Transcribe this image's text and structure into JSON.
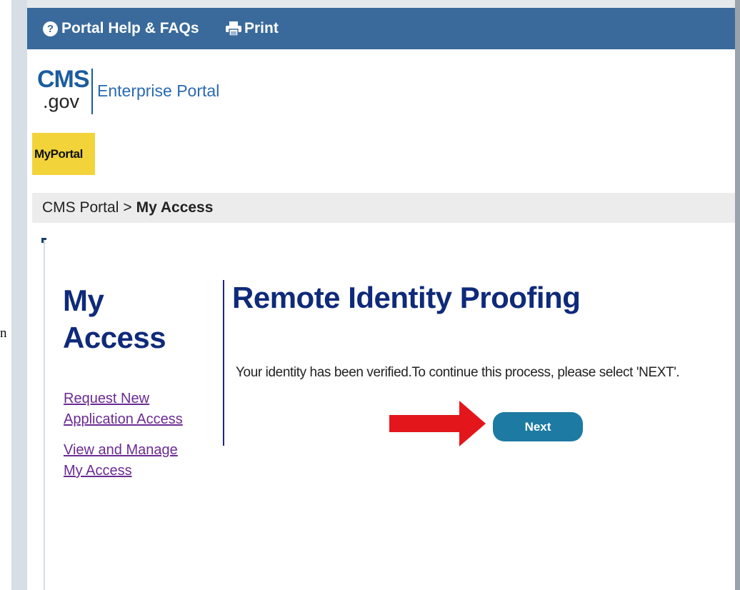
{
  "stray_text": "n",
  "topbar": {
    "help_label": "Portal Help & FAQs",
    "help_icon": "?",
    "print_label": "Print",
    "icons": [
      "question-circle-icon",
      "printer-icon"
    ]
  },
  "logo": {
    "cms": "CMS",
    "gov": ".gov",
    "portal_name": "Enterprise Portal"
  },
  "nav": {
    "tab_label": "MyPortal"
  },
  "breadcrumb": {
    "root": "CMS Portal",
    "separator": ">",
    "current": "My Access"
  },
  "sidebar": {
    "title_line1": "My",
    "title_line2": "Access",
    "links": [
      {
        "line1": "Request New",
        "line2": "Application Access"
      },
      {
        "line1": "View and Manage",
        "line2": "My Access"
      }
    ]
  },
  "main": {
    "heading": "Remote Identity Proofing",
    "message": "Your identity has been verified.To continue this process, please select 'NEXT'.",
    "next_label": "Next"
  },
  "colors": {
    "topbar": "#3a6a9b",
    "tab_highlight": "#f2d43a",
    "heading": "#0f2a7a",
    "link": "#6b2b92",
    "button": "#1d7aa2",
    "annotation_arrow": "#e3161b"
  }
}
